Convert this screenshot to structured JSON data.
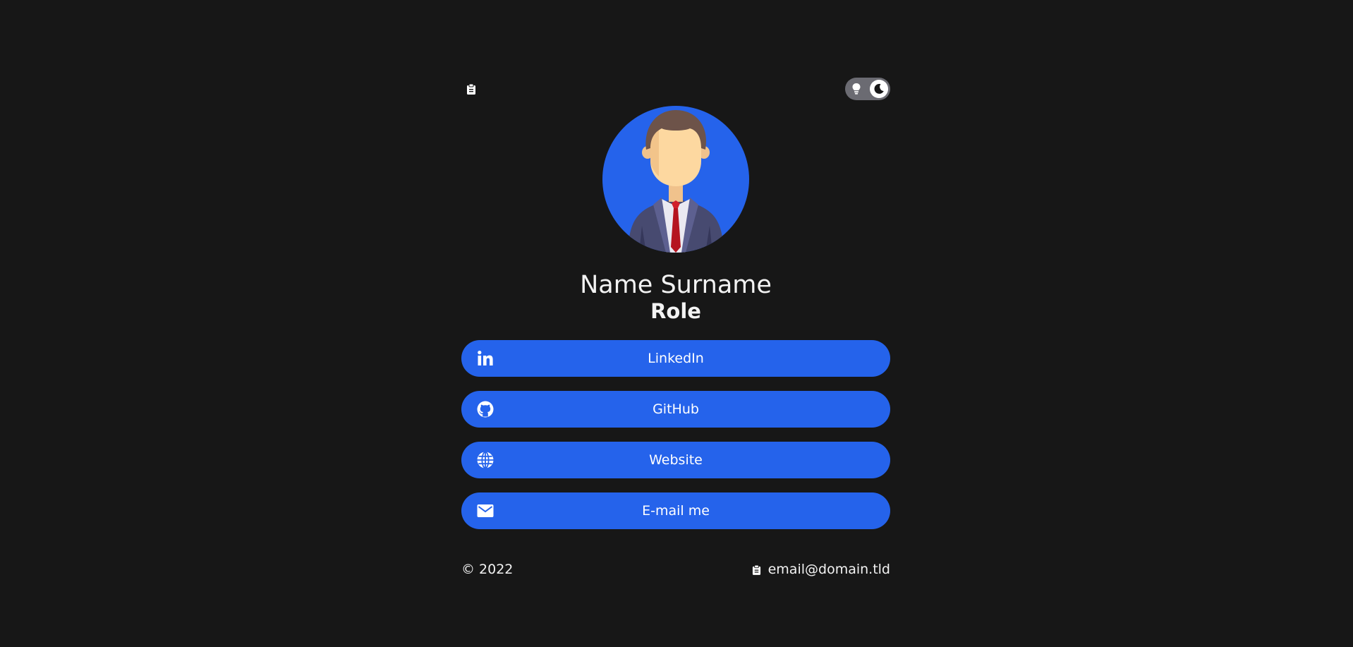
{
  "profile": {
    "name": "Name Surname",
    "role": "Role"
  },
  "links": [
    {
      "label": "LinkedIn",
      "icon": "linkedin-icon"
    },
    {
      "label": "GitHub",
      "icon": "github-icon"
    },
    {
      "label": "Website",
      "icon": "globe-icon"
    },
    {
      "label": "E-mail me",
      "icon": "envelope-icon"
    }
  ],
  "footer": {
    "copyright": "© 2022",
    "email": "email@domain.tld"
  },
  "theme": {
    "mode": "dark",
    "accent": "#2563eb",
    "background": "#171717",
    "toggle_track": "#6b6b72"
  },
  "icons": {
    "top_left": "clipboard-icon",
    "toggle_light": "lightbulb-icon",
    "toggle_dark": "moon-icon",
    "email_copy": "clipboard-icon"
  }
}
